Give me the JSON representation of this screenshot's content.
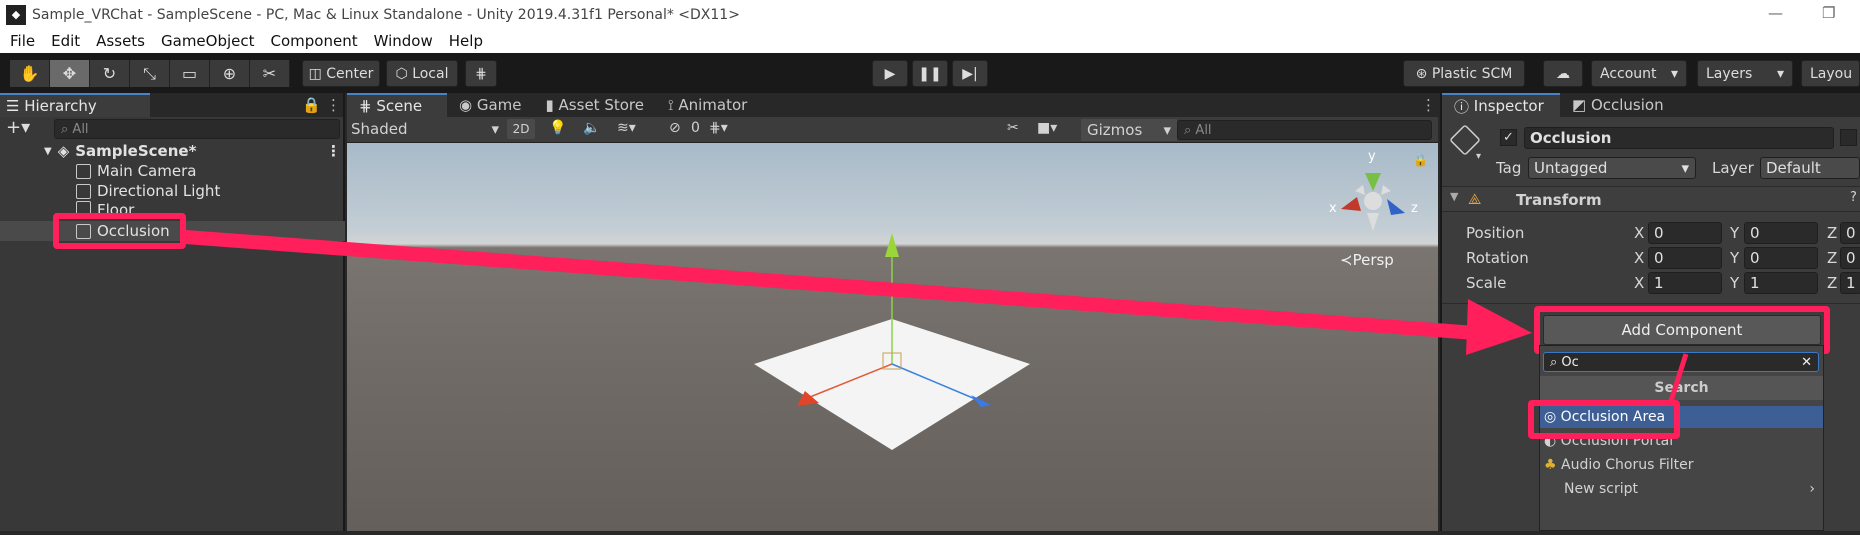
{
  "window": {
    "title": "Sample_VRChat - SampleScene - PC, Mac & Linux Standalone - Unity 2019.4.31f1 Personal* <DX11>"
  },
  "menu": [
    "File",
    "Edit",
    "Assets",
    "GameObject",
    "Component",
    "Window",
    "Help"
  ],
  "toolbar": {
    "pivot": "Center",
    "space": "Local",
    "vcs": "Plastic SCM",
    "account": "Account",
    "layers": "Layers",
    "layout": "Layou"
  },
  "hierarchy": {
    "tab": "Hierarchy",
    "search_placeholder": "All",
    "scene": "SampleScene*",
    "items": [
      "Main Camera",
      "Directional Light",
      "Floor",
      "Occlusion"
    ]
  },
  "scene_tabs": [
    "Scene",
    "Game",
    "Asset Store",
    "Animator"
  ],
  "scene_bar": {
    "shading": "Shaded",
    "mode2d": "2D",
    "fx_count": "0",
    "gizmos": "Gizmos",
    "search_placeholder": "All"
  },
  "viewport": {
    "persp": "Persp",
    "axis_x": "x",
    "axis_y": "y",
    "axis_z": "z"
  },
  "inspector": {
    "tabs": [
      "Inspector",
      "Occlusion"
    ],
    "object_name": "Occlusion",
    "tag_label": "Tag",
    "tag_value": "Untagged",
    "layer_label": "Layer",
    "layer_value": "Default",
    "component": "Transform",
    "rows": [
      {
        "label": "Position",
        "x": "0",
        "y": "0",
        "z": "0"
      },
      {
        "label": "Rotation",
        "x": "0",
        "y": "0",
        "z": "0"
      },
      {
        "label": "Scale",
        "x": "1",
        "y": "1",
        "z": "1"
      }
    ],
    "add_component": "Add Component",
    "popup_search": "Oc",
    "popup_header": "Search",
    "results": [
      "Occlusion Area",
      "Occlusion Portal",
      "Audio Chorus Filter",
      "New script"
    ]
  },
  "colors": {
    "highlight": "#ff1f5a",
    "selection": "#3e5f96",
    "accent": "#4a82c8"
  }
}
